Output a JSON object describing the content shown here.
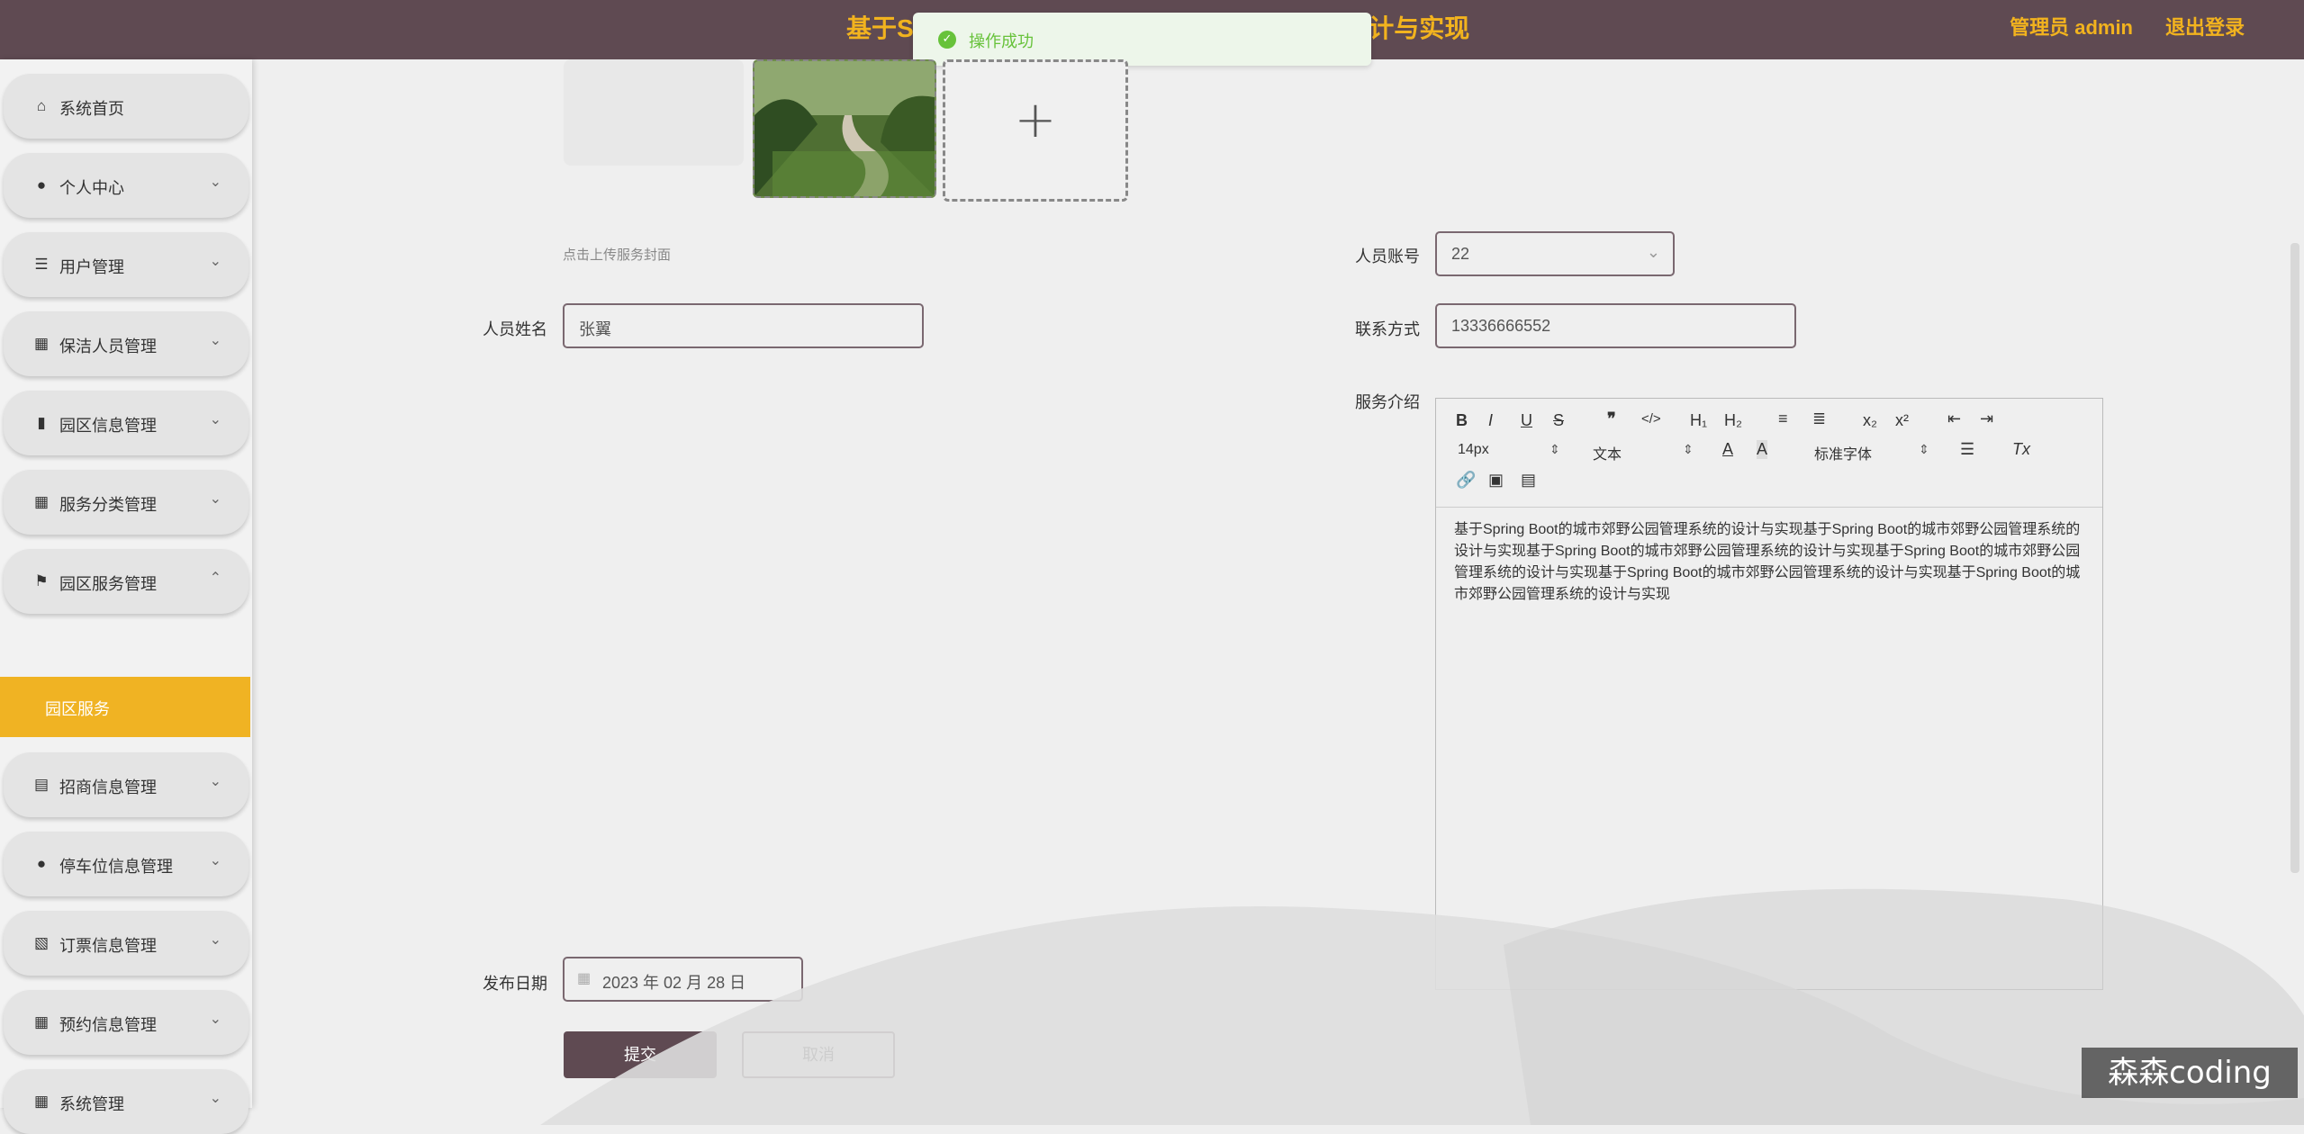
{
  "header": {
    "title": "基于Spring Boot的城市郊野公园管理系统的设计与实现",
    "user": "管理员 admin",
    "logout": "退出登录"
  },
  "toast": {
    "message": "操作成功"
  },
  "sidebar": {
    "items": [
      {
        "label": "系统首页",
        "icon": "home-icon"
      },
      {
        "label": "个人中心",
        "icon": "user-icon"
      },
      {
        "label": "用户管理",
        "icon": "list-icon"
      },
      {
        "label": "保洁人员管理",
        "icon": "grid-icon"
      },
      {
        "label": "园区信息管理",
        "icon": "bar-chart-icon"
      },
      {
        "label": "服务分类管理",
        "icon": "grid-icon"
      },
      {
        "label": "园区服务管理",
        "icon": "flag-icon"
      },
      {
        "label": "招商信息管理",
        "icon": "clipboard-icon"
      },
      {
        "label": "停车位信息管理",
        "icon": "user-icon"
      },
      {
        "label": "订票信息管理",
        "icon": "clipboard-x-icon"
      },
      {
        "label": "预约信息管理",
        "icon": "grid-icon"
      },
      {
        "label": "系统管理",
        "icon": "grid-icon"
      }
    ],
    "active_sub": "园区服务"
  },
  "form": {
    "cover_hint": "点击上传服务封面",
    "name_label": "人员姓名",
    "name_value": "张翼",
    "account_label": "人员账号",
    "account_value": "22",
    "phone_label": "联系方式",
    "phone_value": "13336666552",
    "intro_label": "服务介绍",
    "date_label": "发布日期",
    "date_value": "2023 年 02 月 28 日",
    "submit": "提交",
    "cancel": "取消"
  },
  "editor": {
    "font_size": "14px",
    "block_type": "文本",
    "font_family": "标准字体",
    "content": "基于Spring Boot的城市郊野公园管理系统的设计与实现基于Spring Boot的城市郊野公园管理系统的设计与实现基于Spring Boot的城市郊野公园管理系统的设计与实现基于Spring Boot的城市郊野公园管理系统的设计与实现基于Spring Boot的城市郊野公园管理系统的设计与实现基于Spring Boot的城市郊野公园管理系统的设计与实现"
  },
  "watermark": "森森coding"
}
